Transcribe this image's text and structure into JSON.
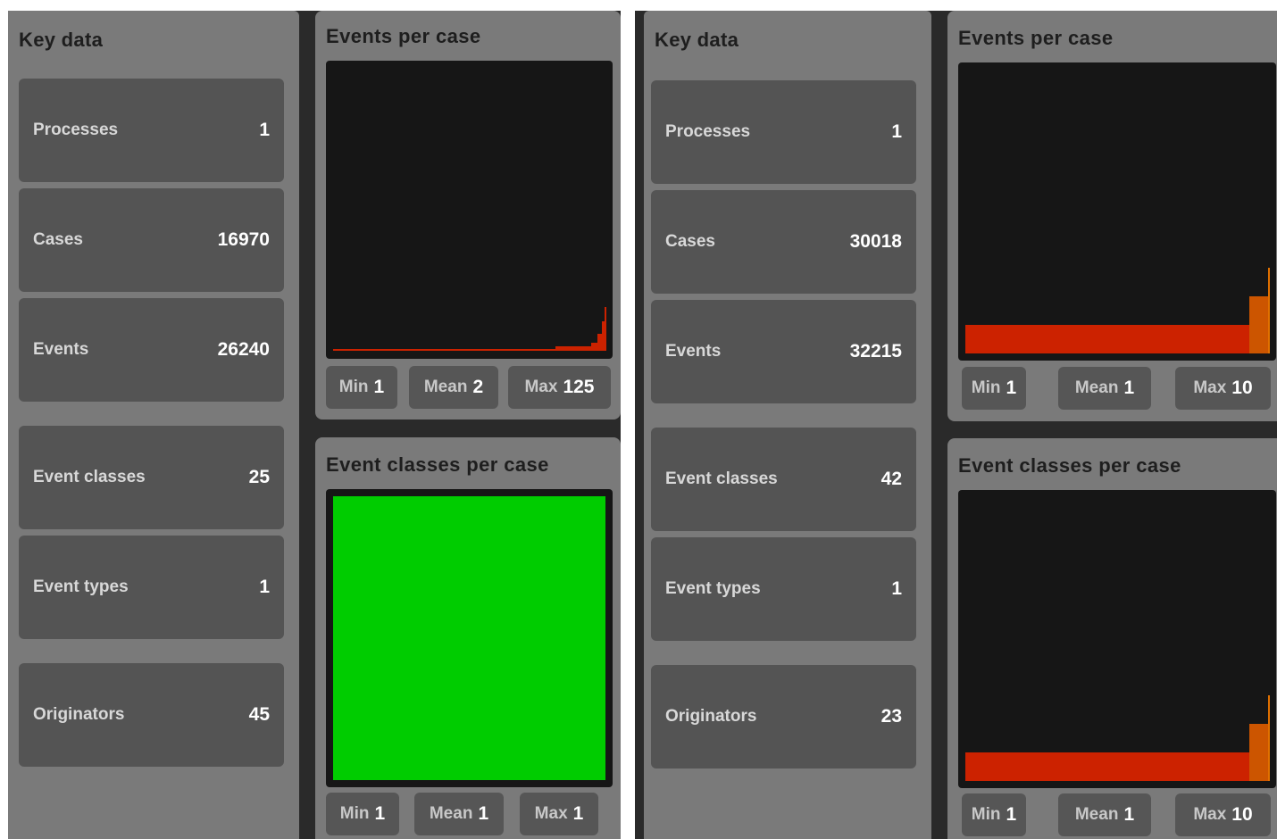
{
  "screens": [
    {
      "key_data": {
        "title": "Key data",
        "items": [
          {
            "label": "Processes",
            "value": "1"
          },
          {
            "label": "Cases",
            "value": "16970"
          },
          {
            "label": "Events",
            "value": "26240"
          },
          {
            "label": "Event classes",
            "value": "25"
          },
          {
            "label": "Event types",
            "value": "1"
          },
          {
            "label": "Originators",
            "value": "45"
          }
        ]
      },
      "events_per_case": {
        "title": "Events per case",
        "stats": {
          "min_label": "Min",
          "min": "1",
          "mean_label": "Mean",
          "mean": "2",
          "max_label": "Max",
          "max": "125"
        }
      },
      "event_classes_per_case": {
        "title": "Event classes per case",
        "stats": {
          "min_label": "Min",
          "min": "1",
          "mean_label": "Mean",
          "mean": "1",
          "max_label": "Max",
          "max": "1"
        }
      }
    },
    {
      "key_data": {
        "title": "Key data",
        "items": [
          {
            "label": "Processes",
            "value": "1"
          },
          {
            "label": "Cases",
            "value": "30018"
          },
          {
            "label": "Events",
            "value": "32215"
          },
          {
            "label": "Event classes",
            "value": "42"
          },
          {
            "label": "Event types",
            "value": "1"
          },
          {
            "label": "Originators",
            "value": "23"
          }
        ]
      },
      "events_per_case": {
        "title": "Events per case",
        "stats": {
          "min_label": "Min",
          "min": "1",
          "mean_label": "Mean",
          "mean": "1",
          "max_label": "Max",
          "max": "10"
        }
      },
      "event_classes_per_case": {
        "title": "Event classes per case",
        "stats": {
          "min_label": "Min",
          "min": "1",
          "mean_label": "Mean",
          "mean": "1",
          "max_label": "Max",
          "max": "10"
        }
      }
    }
  ],
  "colors": {
    "bar_red": "#cc2200",
    "bar_orange": "#cc5500",
    "bar_highlight": "#e07000",
    "bar_green": "#00cc00",
    "plot_bg": "#161616"
  }
}
